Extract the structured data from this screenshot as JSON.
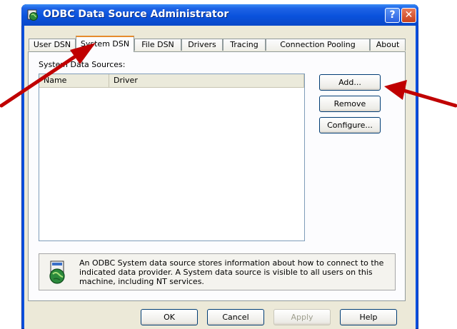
{
  "window": {
    "title": "ODBC Data Source Administrator",
    "help_glyph": "?",
    "close_glyph": "✕"
  },
  "tabs": [
    {
      "label": "User DSN"
    },
    {
      "label": "System DSN"
    },
    {
      "label": "File DSN"
    },
    {
      "label": "Drivers"
    },
    {
      "label": "Tracing"
    },
    {
      "label": "Connection Pooling"
    },
    {
      "label": "About"
    }
  ],
  "panel": {
    "group_label": "System Data Sources:",
    "columns": [
      "Name",
      "Driver"
    ],
    "buttons": {
      "add": "Add...",
      "remove": "Remove",
      "configure": "Configure..."
    },
    "info_text": "An ODBC System data source stores information about how to connect to the indicated data provider.   A System data source is visible to all users on this machine, including NT services."
  },
  "footer": {
    "ok": "OK",
    "cancel": "Cancel",
    "apply": "Apply",
    "help": "Help"
  },
  "colors": {
    "titlebar": "#0a52dc",
    "client": "#ece9d8",
    "active_tab_accent": "#e68b2c",
    "annotation_arrow": "#c00000"
  },
  "icons": {
    "title": "odbc-globe-icon",
    "info": "odbc-database-icon"
  }
}
